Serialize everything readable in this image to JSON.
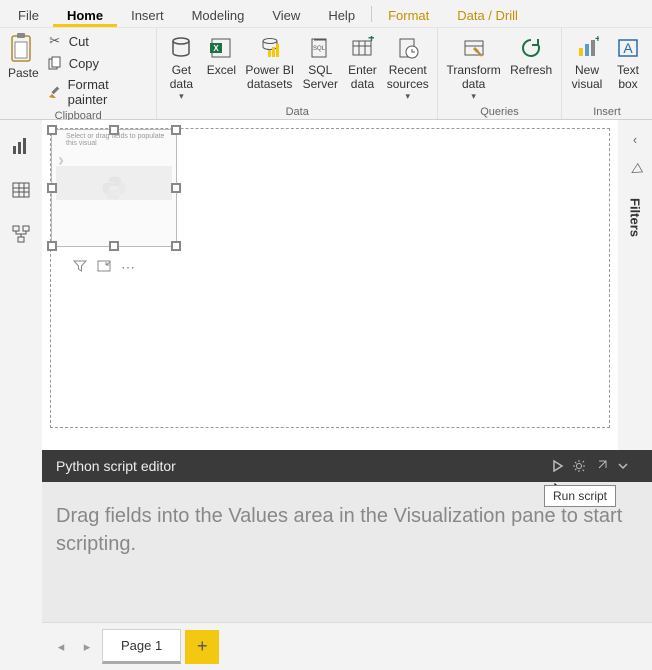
{
  "menu": {
    "file": "File",
    "home": "Home",
    "insert": "Insert",
    "modeling": "Modeling",
    "view": "View",
    "help": "Help",
    "format": "Format",
    "datadrill": "Data / Drill"
  },
  "ribbon": {
    "clipboard": {
      "paste": "Paste",
      "cut": "Cut",
      "copy": "Copy",
      "format_painter": "Format painter",
      "group": "Clipboard"
    },
    "data": {
      "get_data": "Get\ndata",
      "excel": "Excel",
      "pbi_datasets": "Power BI\ndatasets",
      "sql_server": "SQL\nServer",
      "enter_data": "Enter\ndata",
      "recent_sources": "Recent\nsources",
      "group": "Data"
    },
    "queries": {
      "transform": "Transform\ndata",
      "refresh": "Refresh",
      "group": "Queries"
    },
    "insert": {
      "new_visual": "New\nvisual",
      "text_box": "Text\nbox",
      "group": "Insert"
    }
  },
  "right_rail": {
    "filters": "Filters"
  },
  "visual": {
    "placeholder": "Select or drag fields to populate this visual"
  },
  "editor": {
    "title": "Python script editor",
    "run_tooltip": "Run script",
    "placeholder": "Drag fields into the Values area in the Visualization pane to start scripting."
  },
  "pages": {
    "page1": "Page 1"
  }
}
